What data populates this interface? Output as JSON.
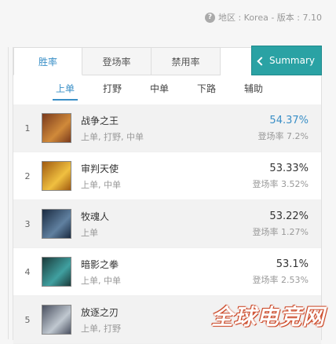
{
  "region": {
    "text": "地区 : Korea - 版本 : 7.10",
    "icon": "question-icon"
  },
  "tabs": [
    {
      "label": "胜率",
      "active": true
    },
    {
      "label": "登场率",
      "active": false
    },
    {
      "label": "禁用率",
      "active": false
    }
  ],
  "summary": {
    "label": "Summary",
    "icon": "chevron-left-icon"
  },
  "subtabs": [
    {
      "label": "上单",
      "active": true
    },
    {
      "label": "打野",
      "active": false
    },
    {
      "label": "中单",
      "active": false
    },
    {
      "label": "下路",
      "active": false
    },
    {
      "label": "辅助",
      "active": false
    }
  ],
  "champions": [
    {
      "rank": "1",
      "name": "战争之王",
      "roles": "上单, 打野, 中单",
      "win": "54.37%",
      "pick": "登场率 7.2%",
      "highlight": true,
      "colors": [
        "#7a3a1c",
        "#d08a3a"
      ]
    },
    {
      "rank": "2",
      "name": "审判天使",
      "roles": "上单, 中单",
      "win": "53.33%",
      "pick": "登场率 3.52%",
      "highlight": false,
      "colors": [
        "#a05a10",
        "#f0c040"
      ]
    },
    {
      "rank": "3",
      "name": "牧魂人",
      "roles": "上单",
      "win": "53.22%",
      "pick": "登场率 1.27%",
      "highlight": false,
      "colors": [
        "#1a2a40",
        "#6080a0"
      ]
    },
    {
      "rank": "4",
      "name": "暗影之拳",
      "roles": "上单, 中单",
      "win": "53.1%",
      "pick": "登场率 2.53%",
      "highlight": false,
      "colors": [
        "#1a3a3a",
        "#40a0a0"
      ]
    },
    {
      "rank": "5",
      "name": "放逐之刃",
      "roles": "上单, 打野",
      "win": "",
      "pick": "",
      "highlight": false,
      "colors": [
        "#4a5060",
        "#c0c8d0"
      ]
    }
  ],
  "watermark": "全球电竞网"
}
